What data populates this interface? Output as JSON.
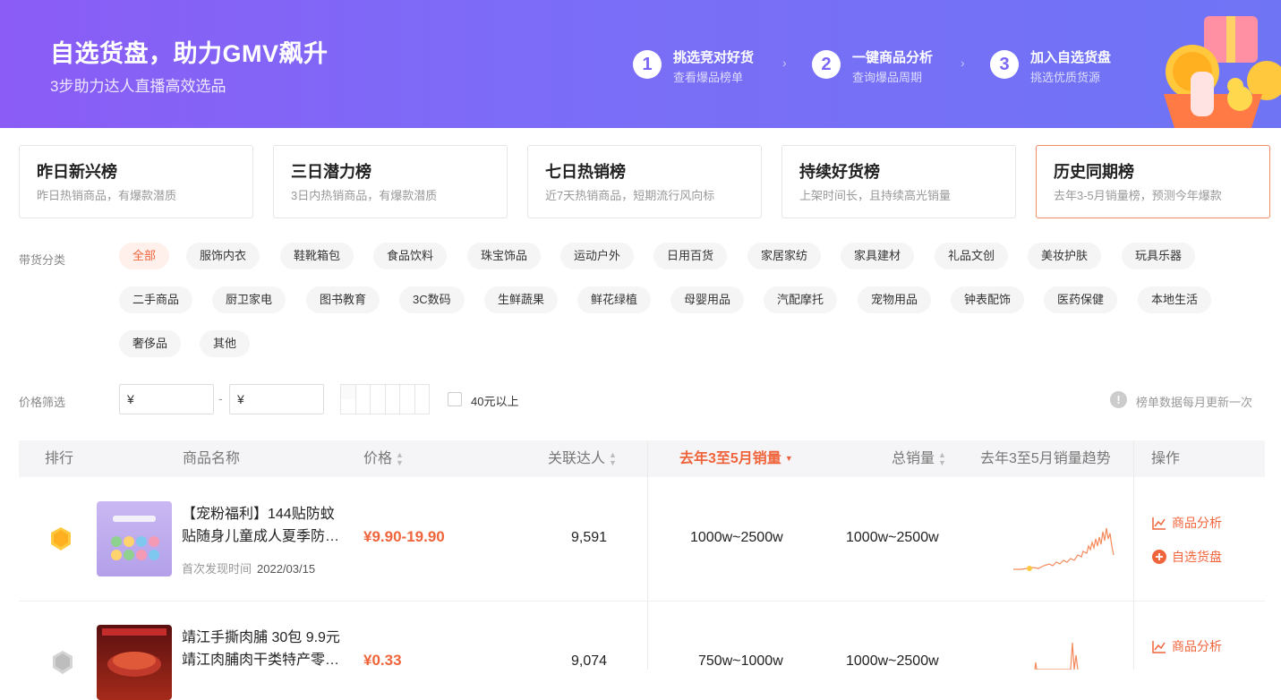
{
  "banner": {
    "title": "自选货盘，助力GMV飙升",
    "subtitle": "3步助力达人直播高效选品",
    "steps": [
      {
        "num": "1",
        "title": "挑选竞对好货",
        "desc": "查看爆品榜单"
      },
      {
        "num": "2",
        "title": "一键商品分析",
        "desc": "查询爆品周期"
      },
      {
        "num": "3",
        "title": "加入自选货盘",
        "desc": "挑选优质货源"
      }
    ],
    "arrow": "›"
  },
  "rank_cards": [
    {
      "title": "昨日新兴榜",
      "desc": "昨日热销商品，有爆款潜质"
    },
    {
      "title": "三日潜力榜",
      "desc": "3日内热销商品，有爆款潜质"
    },
    {
      "title": "七日热销榜",
      "desc": "近7天热销商品，短期流行风向标"
    },
    {
      "title": "持续好货榜",
      "desc": "上架时间长，且持续高光销量"
    },
    {
      "title": "历史同期榜",
      "desc": "去年3-5月销量榜，预测今年爆款"
    }
  ],
  "categories": {
    "label": "带货分类",
    "items": [
      "全部",
      "服饰内衣",
      "鞋靴箱包",
      "食品饮料",
      "珠宝饰品",
      "运动户外",
      "日用百货",
      "家居家纺",
      "家具建材",
      "礼品文创",
      "美妆护肤",
      "玩具乐器",
      "二手商品",
      "厨卫家电",
      "图书教育",
      "3C数码",
      "生鲜蔬果",
      "鲜花绿植",
      "母婴用品",
      "汽配摩托",
      "宠物用品",
      "钟表配饰",
      "医药保健",
      "本地生活",
      "奢侈品",
      "其他"
    ],
    "active": "全部"
  },
  "price_filter": {
    "label": "价格筛选",
    "min_prefix": "¥",
    "max_prefix": "¥",
    "dash": "-",
    "checkbox_label": "40元以上",
    "info_icon": "!",
    "info_text": "榜单数据每月更新一次"
  },
  "table": {
    "headers": {
      "rank": "排行",
      "name": "商品名称",
      "price": "价格",
      "talents": "关联达人",
      "sales_period": "去年3至5月销量",
      "total_sales": "总销量",
      "trend": "去年3至5月销量趋势",
      "ops": "操作"
    },
    "sort_arrows": {
      "up": "▲",
      "down": "▼"
    },
    "rows": [
      {
        "rank": "1",
        "name_l1": "【宠粉福利】144贴防蚊",
        "name_l2": "贴随身儿童成人夏季防…",
        "first_label": "首次发现时间",
        "first_date": "2022/03/15",
        "price": "¥9.90-19.90",
        "talents": "9,591",
        "sales_period": "1000w~2500w",
        "total_sales": "1000w~2500w",
        "op_analysis": "商品分析",
        "op_add": "自选货盘",
        "thumb_text": "天然植物防蚊贴"
      },
      {
        "rank": "2",
        "name_l1": "靖江手撕肉脯 30包 9.9元",
        "name_l2": "靖江肉脯肉干类特产零…",
        "price": "¥0.33",
        "talents": "9,074",
        "sales_period": "750w~1000w",
        "total_sales": "1000w~2500w",
        "op_analysis": "商品分析",
        "thumb_text": "靖江肉脯"
      }
    ]
  },
  "colors": {
    "accent": "#f0643c",
    "banner_start": "#8b5cf6",
    "banner_end": "#6f74f5"
  }
}
